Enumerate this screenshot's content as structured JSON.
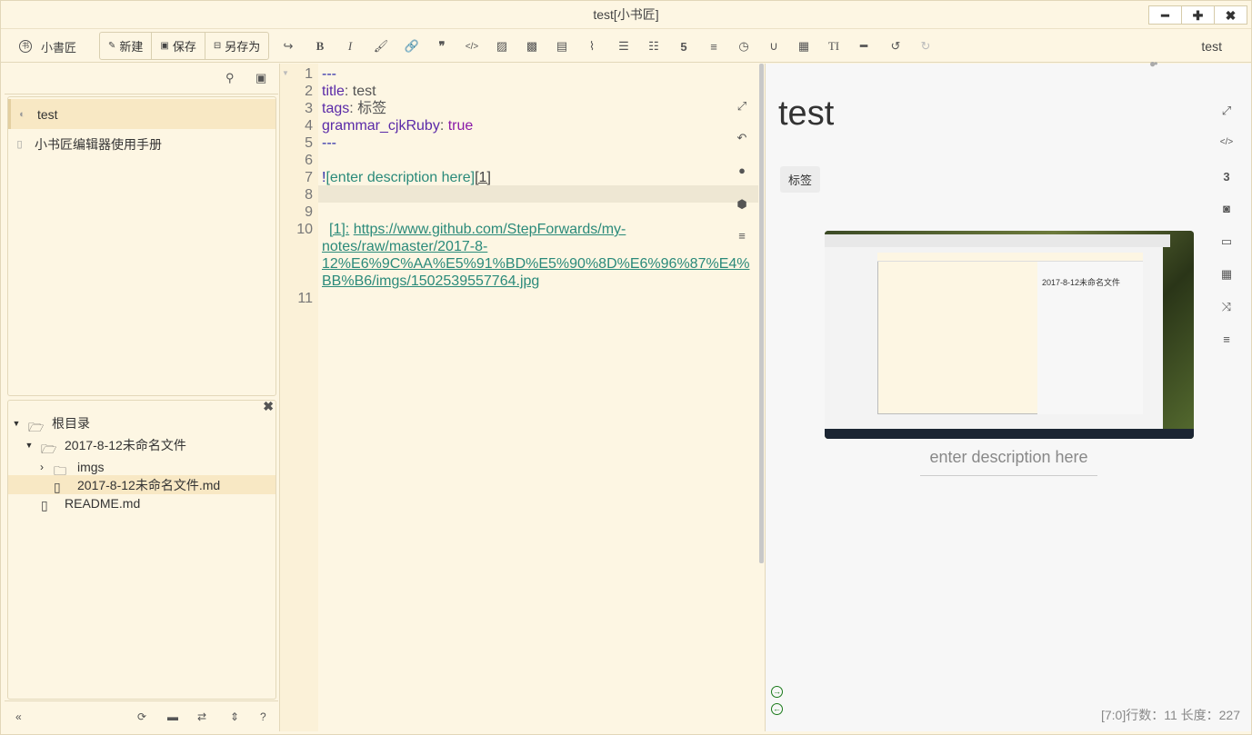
{
  "window": {
    "title": "test[小书匠]",
    "min": "━",
    "max": "✚",
    "close": "✖"
  },
  "toolbar": {
    "logo": "小書匠",
    "new_label": "新建",
    "save_label": "保存",
    "saveas_label": "另存为",
    "doc_name": "test",
    "tools": [
      "redo-icon",
      "bold-icon",
      "italic-icon",
      "brush-icon",
      "link-icon",
      "quote-icon",
      "code-icon",
      "image-icon",
      "video-icon",
      "file-icon",
      "attachment-icon",
      "ordered-list-icon",
      "unordered-list-icon",
      "html5-icon",
      "hr-icon",
      "clock-icon",
      "magnet-icon",
      "table-icon",
      "heading-icon",
      "minus-icon",
      "undo-icon",
      "redo-disabled-icon"
    ]
  },
  "sidebar": {
    "docs": [
      {
        "label": "test",
        "selected": true
      },
      {
        "label": "小书匠编辑器使用手册",
        "selected": false
      }
    ],
    "tree": {
      "root": "根目录",
      "folder": "2017-8-12未命名文件",
      "imgs": "imgs",
      "file_md": "2017-8-12未命名文件.md",
      "readme": "README.md"
    }
  },
  "editor": {
    "line_numbers": [
      "1",
      "2",
      "3",
      "4",
      "5",
      "6",
      "7",
      "8",
      "9",
      "10",
      "",
      "",
      "",
      "11"
    ],
    "l1": "---",
    "l2_key": "title",
    "l2_val": "test",
    "l3_key": "tags",
    "l3_val": "标签",
    "l4_key": "grammar_cjkRuby",
    "l4_val": "true",
    "l5": "---",
    "l7_bang": "!",
    "l7_alt": "[enter description here]",
    "l7_ref": "[1]",
    "l10_ref": "[1]:",
    "l10_url1": "https://www.github.com/StepForwards/my-",
    "l10_url2": "notes/raw/master/2017-8-",
    "l10_url3": "12%E6%9C%AA%E5%91%BD%E5%90%8D%E6%96%87%E4%",
    "l10_url4": "BB%B6/imgs/1502539557764.jpg"
  },
  "preview": {
    "title": "test",
    "tag": "标签",
    "caption": "enter description here",
    "status": "[7:0]行数：11 长度：227",
    "inner_title": "2017-8-12未命名文件"
  }
}
